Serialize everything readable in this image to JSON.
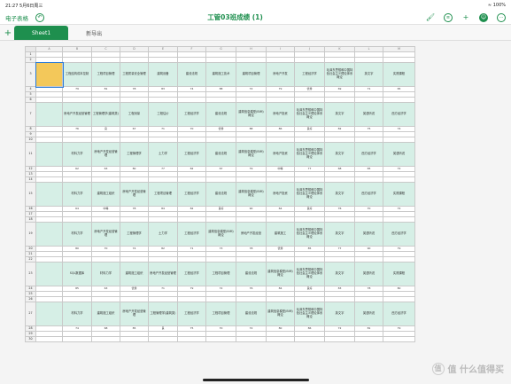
{
  "status": {
    "time": "21:27",
    "date": "5月6日周三",
    "right": "≈ 100%"
  },
  "header": {
    "back_label": "电子表格",
    "title": "工管03班成绩 (1)"
  },
  "tabs": [
    {
      "label": "Sheet1"
    },
    {
      "label": "新导出"
    }
  ],
  "columns": [
    "A",
    "B",
    "C",
    "D",
    "E",
    "F",
    "G",
    "H",
    "I",
    "J",
    "K",
    "L",
    "M"
  ],
  "blocks": [
    {
      "hdr_row": "3",
      "val_row": "4",
      "headers": [
        "",
        "工程结构成本控制",
        "工程项目管理",
        "工程质量安全管理",
        "建筑设备",
        "建设法规",
        "建筑施工技术",
        "建筑项目管理",
        "房地产开发",
        "工程经济学",
        "毛泽东思想和中国特色社会主义理论体系概论",
        "英文字",
        "实践课程"
      ],
      "values": [
        "",
        "79",
        "81",
        "78",
        "83",
        "74",
        "88",
        "72",
        "79",
        "优秀",
        "69",
        "71",
        "65"
      ]
    },
    {
      "hdr_row": "7",
      "val_row": "8",
      "headers": [
        "",
        "房地产开发经营管理",
        "工程管理学(建筑类)",
        "工程测量",
        "工程估价",
        "工程经济学",
        "建设法规",
        "建筑信息模型(BIM)概论",
        "房地产投资",
        "毛泽东思想和中国特色社会主义理论体系概论",
        "英文字",
        "英语听说",
        "西方经济学"
      ],
      "values": [
        "",
        "76",
        "良",
        "67",
        "71",
        "70",
        "优秀",
        "88",
        "86",
        "良好",
        "82",
        "75",
        "74"
      ]
    },
    {
      "hdr_row": "11",
      "val_row": "12",
      "headers": [
        "",
        "材料力学",
        "房地产开发经营管理",
        "工程管理学",
        "土力学",
        "工程经济学",
        "建设法规",
        "建筑信息模型(BIM)概论",
        "房地产投资",
        "毛泽东思想和中国特色社会主义理论体系概论",
        "英文字",
        "西方经济学",
        "英语听说"
      ],
      "values": [
        "",
        "62",
        "63",
        "80",
        "77",
        "82",
        "67",
        "79",
        "中等",
        "77",
        "68",
        "65",
        "72"
      ]
    },
    {
      "hdr_row": "15",
      "val_row": "16",
      "headers": [
        "",
        "材料力学",
        "建筑施工组织",
        "房地产开发经营管理",
        "工程项目管理",
        "工程经济学",
        "建设法规",
        "建筑信息模型(BIM)概论",
        "房地产投资",
        "毛泽东思想和中国特色社会主义理论体系概论",
        "英文字",
        "西方经济学",
        "实践课程"
      ],
      "values": [
        "",
        "64",
        "中等",
        "78",
        "84",
        "82",
        "良好",
        "90",
        "64",
        "良好",
        "76",
        "70",
        "72"
      ]
    },
    {
      "hdr_row": "19",
      "val_row": "20",
      "headers": [
        "",
        "材料力学",
        "房地产开发经营管理",
        "工程管理学",
        "土力学",
        "工程经济学",
        "建筑信息模型(BIM)概论",
        "房地产开发经营",
        "建筑施工",
        "毛泽东思想和中国特色社会主义理论体系概论",
        "英文字",
        "英语听说",
        "西方经济学"
      ],
      "values": [
        "",
        "80",
        "70",
        "74",
        "82",
        "71",
        "73",
        "78",
        "优秀",
        "85",
        "77",
        "90",
        "79"
      ]
    },
    {
      "hdr_row": "23",
      "val_row": "24",
      "headers": [
        "",
        "SQL数据库",
        "材料力学",
        "建筑施工组织",
        "房地产开发经营管理",
        "工程经济学",
        "工程项目管理",
        "建设法规",
        "建筑信息模型(BIM)概论",
        "毛泽东思想和中国特色社会主义理论体系概论",
        "英文字",
        "英语听说",
        "实践课程"
      ],
      "values": [
        "",
        "85",
        "63",
        "优秀",
        "71",
        "79",
        "72",
        "76",
        "84",
        "良好",
        "83",
        "78",
        "80"
      ]
    },
    {
      "hdr_row": "27",
      "val_row": "28",
      "headers": [
        "",
        "材料力学",
        "建筑施工组织",
        "房地产开发经营管理",
        "工程管理学(建筑类)",
        "工程经济学",
        "工程项目管理",
        "建设法规",
        "建筑信息模型(BIM)概论",
        "毛泽东思想和中国特色社会主义理论体系概论",
        "英文字",
        "英语听说",
        "西方经济学"
      ],
      "values": [
        "",
        "74",
        "68",
        "85",
        "良",
        "75",
        "70",
        "72",
        "80",
        "86",
        "72",
        "81",
        "79"
      ]
    }
  ],
  "watermark": "值 什么值得买"
}
